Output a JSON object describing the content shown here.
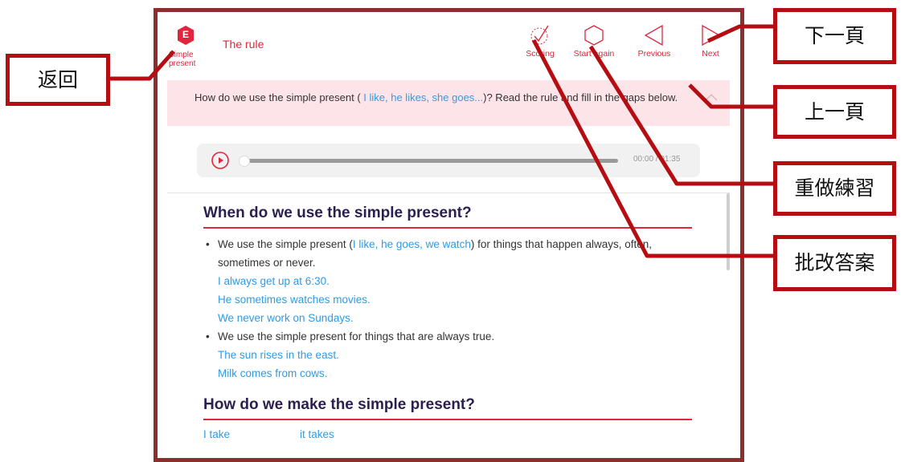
{
  "toolbar": {
    "back_badge": "E",
    "back_label": "Simple present",
    "title": "The rule",
    "scoring": "Scoring",
    "start_again": "Start again",
    "previous": "Previous",
    "next": "Next"
  },
  "banner": {
    "text_before": "How do we use the simple present ( ",
    "examples": "I like, he likes, she goes...",
    "text_after": ")? Read the rule and fill in the gaps below."
  },
  "audio": {
    "time": "00:00 / 01:35",
    "progress": 0
  },
  "section1": {
    "heading": "When do we use the simple present?",
    "bullet1_before": "We use the simple present (",
    "bullet1_examples": "I like, he goes, we watch",
    "bullet1_after": ") for things that happen always, often, sometimes or never.",
    "bullet1_sentences": [
      "I always get up at 6:30.",
      "He sometimes watches movies.",
      "We never work on Sundays."
    ],
    "bullet2_text": "We use the simple present for things that are always true.",
    "bullet2_sentences": [
      "The sun rises in the east.",
      "Milk comes from cows."
    ]
  },
  "section2": {
    "heading": "How do we make the simple present?",
    "forms": [
      "I take",
      "it takes"
    ]
  },
  "callouts": {
    "back": "返回",
    "next": "下一頁",
    "previous": "上一頁",
    "restart": "重做練習",
    "scoring": "批改答案"
  },
  "colors": {
    "accent": "#e0253c",
    "frame": "#8b2e2e",
    "callout_border": "#b50d12",
    "example_blue": "#2e9be6"
  }
}
